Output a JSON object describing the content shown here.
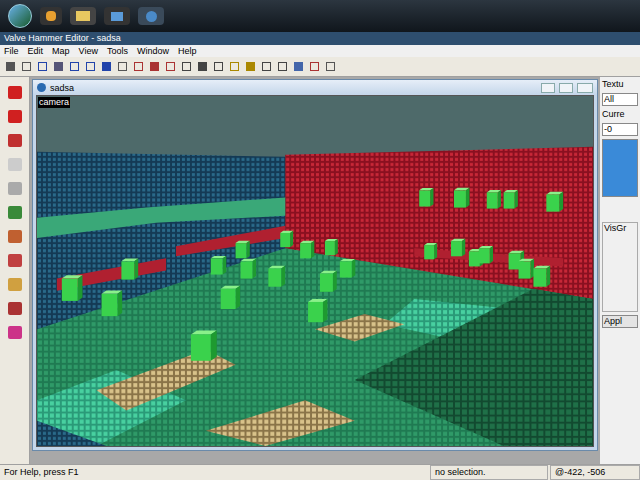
{
  "window": {
    "title": "Valve Hammer Editor - sadsa"
  },
  "menu": [
    "File",
    "Edit",
    "Map",
    "View",
    "Tools",
    "Window",
    "Help"
  ],
  "child_window": {
    "title": "sadsa",
    "viewport_label": "camera"
  },
  "right_panel": {
    "texture_label": "Textu",
    "filter": "All",
    "current_label": "Curre",
    "current_value": "-0",
    "visgroups_label": "VisGr",
    "apply_button": "Appl"
  },
  "status_bar": {
    "help": "For Help, press F1",
    "selection": "no selection.",
    "coords": "@-422, -506"
  }
}
